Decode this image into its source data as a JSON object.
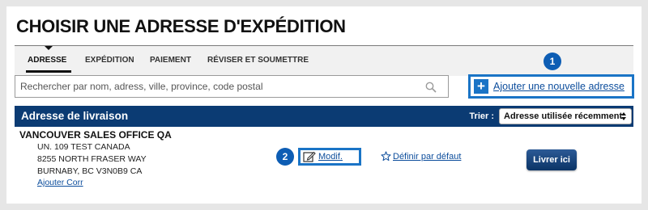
{
  "page": {
    "title": "CHOISIR UNE ADRESSE D'EXPÉDITION"
  },
  "steps": [
    {
      "label": "ADRESSE",
      "active": true
    },
    {
      "label": "EXPÉDITION",
      "active": false
    },
    {
      "label": "PAIEMENT",
      "active": false
    },
    {
      "label": "RÉVISER ET SOUMETTRE",
      "active": false
    }
  ],
  "search": {
    "placeholder": "Rechercher par nom, adress, ville, province, code postal",
    "value": "",
    "icon": "search-icon"
  },
  "add_address": {
    "label": "Ajouter une nouvelle adresse",
    "icon": "plus-icon",
    "callout": "1"
  },
  "address_header": {
    "title": "Adresse de livraison",
    "sort_label": "Trier :",
    "sort_selected": "Adresse utilisée récemment"
  },
  "address": {
    "name": "VANCOUVER SALES OFFICE QA",
    "lines": [
      "UN. 109 TEST CANADA",
      "8255 NORTH FRASER WAY",
      "BURNABY, BC V3N0B9 CA"
    ],
    "add_corr_label": "Ajouter Corr",
    "edit_label": "Modif.",
    "edit_icon": "edit-icon",
    "edit_callout": "2",
    "set_default_label": "Définir par défaut",
    "set_default_icon": "star-icon",
    "deliver_label": "Livrer ici"
  },
  "colors": {
    "accent": "#1a74c6",
    "header_bg": "#0b3b73",
    "link": "#0c4d9c",
    "callout": "#0d5db4"
  }
}
